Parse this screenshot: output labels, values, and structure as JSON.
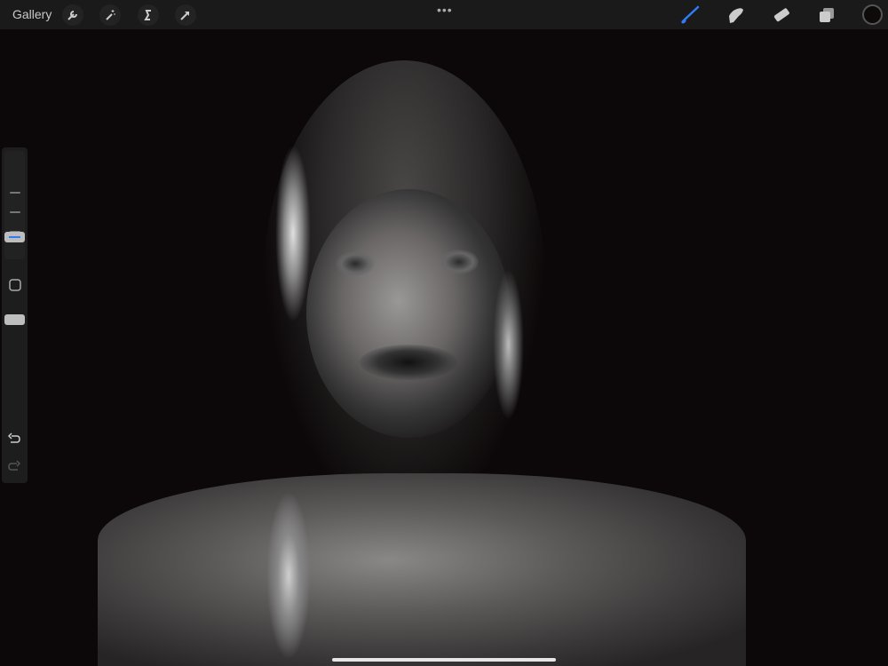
{
  "topbar": {
    "gallery_label": "Gallery",
    "left_icons": [
      "wrench-icon",
      "magic-wand-icon",
      "selection-s-icon",
      "transform-arrow-icon"
    ],
    "more_label": "•••",
    "right_icons": [
      "brush-icon",
      "smudge-icon",
      "eraser-icon",
      "layers-icon",
      "color-icon"
    ],
    "active_tool": "brush",
    "accent_color": "#2f7cf6",
    "current_color": "#0e0a0a"
  },
  "sidebar": {
    "brush_size_fraction": 0.17,
    "opacity_fraction": 0.67,
    "icons": [
      "modify-square-icon",
      "undo-icon",
      "redo-icon"
    ]
  }
}
